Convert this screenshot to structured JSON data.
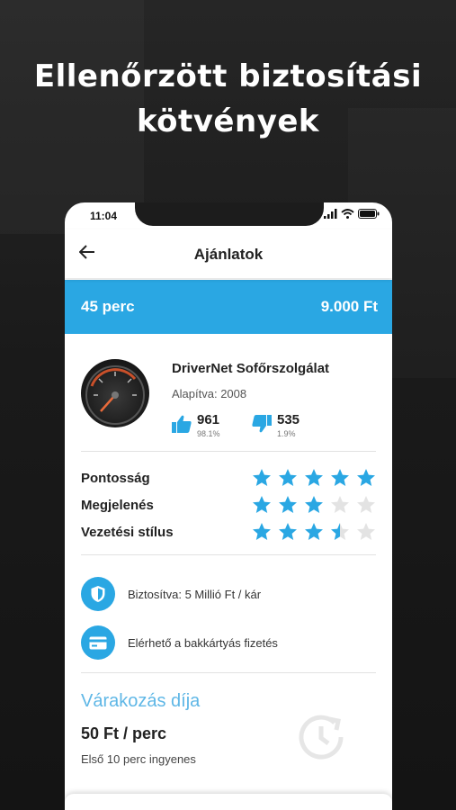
{
  "headline": {
    "line1": "Ellenőrzött biztosítási",
    "line2": "kötvények"
  },
  "status_bar": {
    "time": "11:04"
  },
  "app_bar": {
    "title": "Ajánlatok"
  },
  "summary": {
    "duration": "45 perc",
    "price": "9.000 Ft"
  },
  "company": {
    "name": "DriverNet Sofőrszolgálat",
    "founded": "Alapítva: 2008",
    "likes": {
      "count": "961",
      "percent": "98.1%"
    },
    "dislikes": {
      "count": "535",
      "percent": "1.9%"
    }
  },
  "ratings": [
    {
      "label": "Pontosság",
      "stars": 5
    },
    {
      "label": "Megjelenés",
      "stars": 3
    },
    {
      "label": "Vezetési stílus",
      "stars": 3.5
    }
  ],
  "features": [
    {
      "icon": "shield-icon",
      "text": "Biztosítva: 5 Millió Ft / kár"
    },
    {
      "icon": "credit-card-icon",
      "text": "Elérhető a bakkártyás fizetés"
    }
  ],
  "waiting_fee": {
    "title": "Várakozás díja",
    "price": "50 Ft / perc",
    "note": "Első 10 perc ingyenes"
  },
  "colors": {
    "accent": "#2aa7e3",
    "star_empty": "#e3e3e3",
    "wait_title": "#5fb7e6"
  }
}
